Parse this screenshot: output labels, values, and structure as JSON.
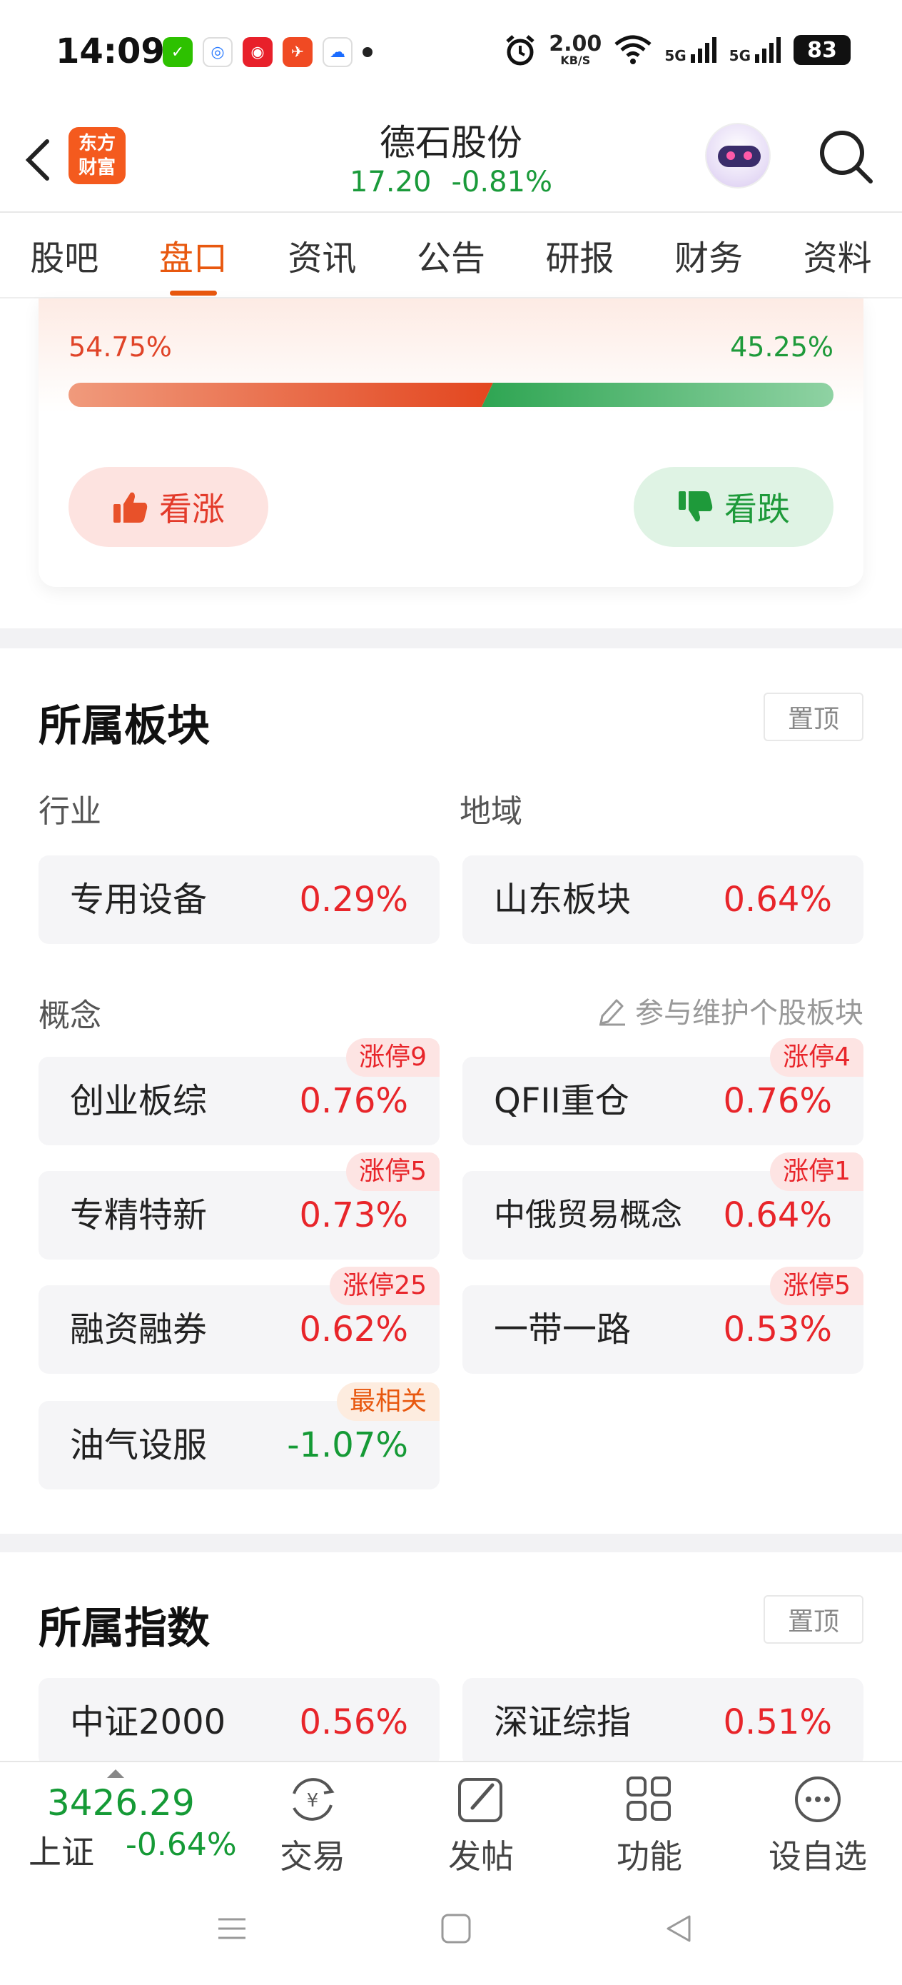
{
  "status_bar": {
    "time": "14:09",
    "speed_value": "2.00",
    "speed_unit": "KB/S",
    "signal1": "5G",
    "signal2": "5G",
    "battery": "83",
    "app_icons": [
      "wechat-icon",
      "browser-icon",
      "netease-music-icon",
      "message-icon",
      "cloud-icon"
    ]
  },
  "header": {
    "logo_line1": "东方",
    "logo_line2": "财富",
    "stock_name": "德石股份",
    "price": "17.20",
    "change_pct": "-0.81%",
    "colors": {
      "brand": "#f45a1e",
      "down": "#159a36",
      "up": "#e8252a"
    }
  },
  "tabs": [
    {
      "label": "股吧",
      "active": false
    },
    {
      "label": "盘口",
      "active": true
    },
    {
      "label": "资讯",
      "active": false
    },
    {
      "label": "公告",
      "active": false
    },
    {
      "label": "研报",
      "active": false
    },
    {
      "label": "财务",
      "active": false
    },
    {
      "label": "资料",
      "active": false
    }
  ],
  "vote": {
    "bull_pct_label": "54.75%",
    "bear_pct_label": "45.25%",
    "bull_fraction": 0.5475,
    "bear_fraction": 0.4525,
    "bull_button": "看涨",
    "bear_button": "看跌"
  },
  "sectors": {
    "title": "所属板块",
    "pin_label": "置顶",
    "industry_label": "行业",
    "region_label": "地域",
    "industry": {
      "name": "专用设备",
      "value": "0.29%"
    },
    "region": {
      "name": "山东板块",
      "value": "0.64%"
    },
    "concept_label": "概念",
    "maintain_label": "参与维护个股板块",
    "concepts": [
      {
        "name": "创业板综",
        "value": "0.76%",
        "badge": "涨停9",
        "direction": "up"
      },
      {
        "name": "QFII重仓",
        "value": "0.76%",
        "badge": "涨停4",
        "direction": "up"
      },
      {
        "name": "专精特新",
        "value": "0.73%",
        "badge": "涨停5",
        "direction": "up"
      },
      {
        "name": "中俄贸易概念",
        "value": "0.64%",
        "badge": "涨停1",
        "direction": "up"
      },
      {
        "name": "融资融券",
        "value": "0.62%",
        "badge": "涨停25",
        "direction": "up"
      },
      {
        "name": "一带一路",
        "value": "0.53%",
        "badge": "涨停5",
        "direction": "up"
      },
      {
        "name": "油气设服",
        "value": "-1.07%",
        "badge": "最相关",
        "direction": "down"
      }
    ]
  },
  "indices": {
    "title": "所属指数",
    "pin_label": "置顶",
    "items": [
      {
        "name": "中证2000",
        "value": "0.56%"
      },
      {
        "name": "深证综指",
        "value": "0.51%"
      }
    ]
  },
  "bottom_bar": {
    "index_value": "3426.29",
    "index_name": "上证",
    "index_change": "-0.64%",
    "items": [
      {
        "label": "交易",
        "icon": "trade-yuan-icon"
      },
      {
        "label": "发帖",
        "icon": "edit-post-icon"
      },
      {
        "label": "功能",
        "icon": "grid-apps-icon"
      },
      {
        "label": "设自选",
        "icon": "more-dots-icon"
      }
    ]
  }
}
